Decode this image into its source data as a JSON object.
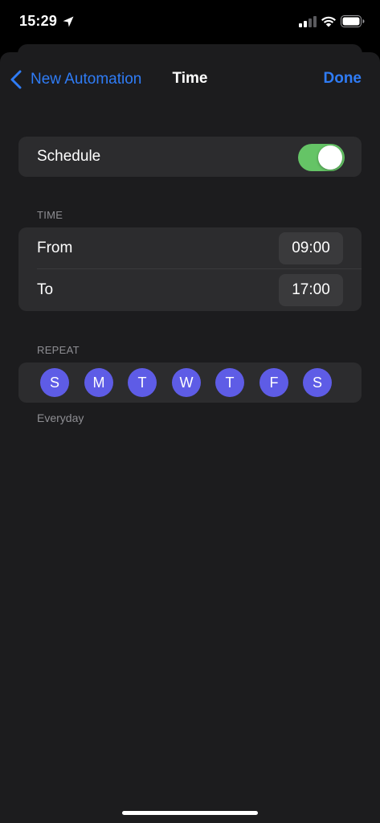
{
  "status_bar": {
    "time": "15:29",
    "icons": [
      "location-icon",
      "signal-icon",
      "wifi-icon",
      "battery-icon"
    ]
  },
  "nav": {
    "back_label": "New Automation",
    "title": "Time",
    "done_label": "Done"
  },
  "schedule": {
    "label": "Schedule",
    "enabled": true
  },
  "time_section": {
    "header": "TIME",
    "from_label": "From",
    "from_value": "09:00",
    "to_label": "To",
    "to_value": "17:00"
  },
  "repeat_section": {
    "header": "REPEAT",
    "days": [
      "S",
      "M",
      "T",
      "W",
      "T",
      "F",
      "S"
    ],
    "summary": "Everyday"
  },
  "colors": {
    "accent": "#2f7cf6",
    "toggle_on": "#65c466",
    "day_selected": "#5e5ce6",
    "sheet_bg": "#1c1c1e",
    "card_bg": "#2c2c2e"
  }
}
